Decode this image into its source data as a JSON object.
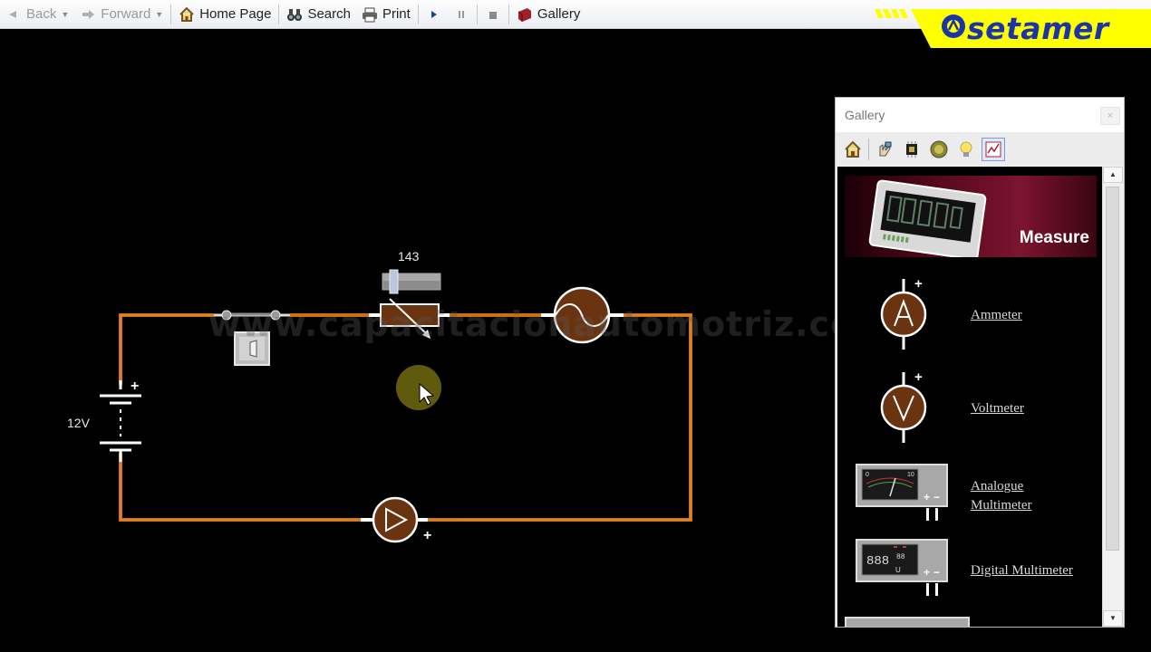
{
  "toolbar": {
    "back": "Back",
    "forward": "Forward",
    "home": "Home Page",
    "search": "Search",
    "print": "Print",
    "gallery": "Gallery"
  },
  "brand": {
    "name": "setamer"
  },
  "circuit": {
    "resistor_value": "143",
    "battery_label": "12V",
    "battery_plus": "+",
    "ammeter_plus": "+"
  },
  "watermark": "www.capacitacionautomotriz.com",
  "gallery": {
    "title": "Gallery",
    "close": "×",
    "measure_label": "Measure",
    "items": [
      {
        "label": "Ammeter",
        "icon": "ammeter-icon"
      },
      {
        "label": "Voltmeter",
        "icon": "voltmeter-icon"
      },
      {
        "label": "Analogue Multimeter",
        "icon": "analogue-multimeter-icon"
      },
      {
        "label": "Digital Multimeter",
        "icon": "digital-multimeter-icon"
      }
    ],
    "ammeter_symbol": "A",
    "voltmeter_symbol": "V",
    "plus": "+",
    "minus": "−",
    "analogue_scale_min": "0",
    "analogue_scale_max": "10",
    "digital_display": "888",
    "digital_small": "88",
    "digital_mode": "U"
  },
  "colors": {
    "wire": "#cf6f14",
    "component": "#6b3411",
    "brand_yellow": "#ffff00",
    "brand_blue": "#1b34a8"
  }
}
